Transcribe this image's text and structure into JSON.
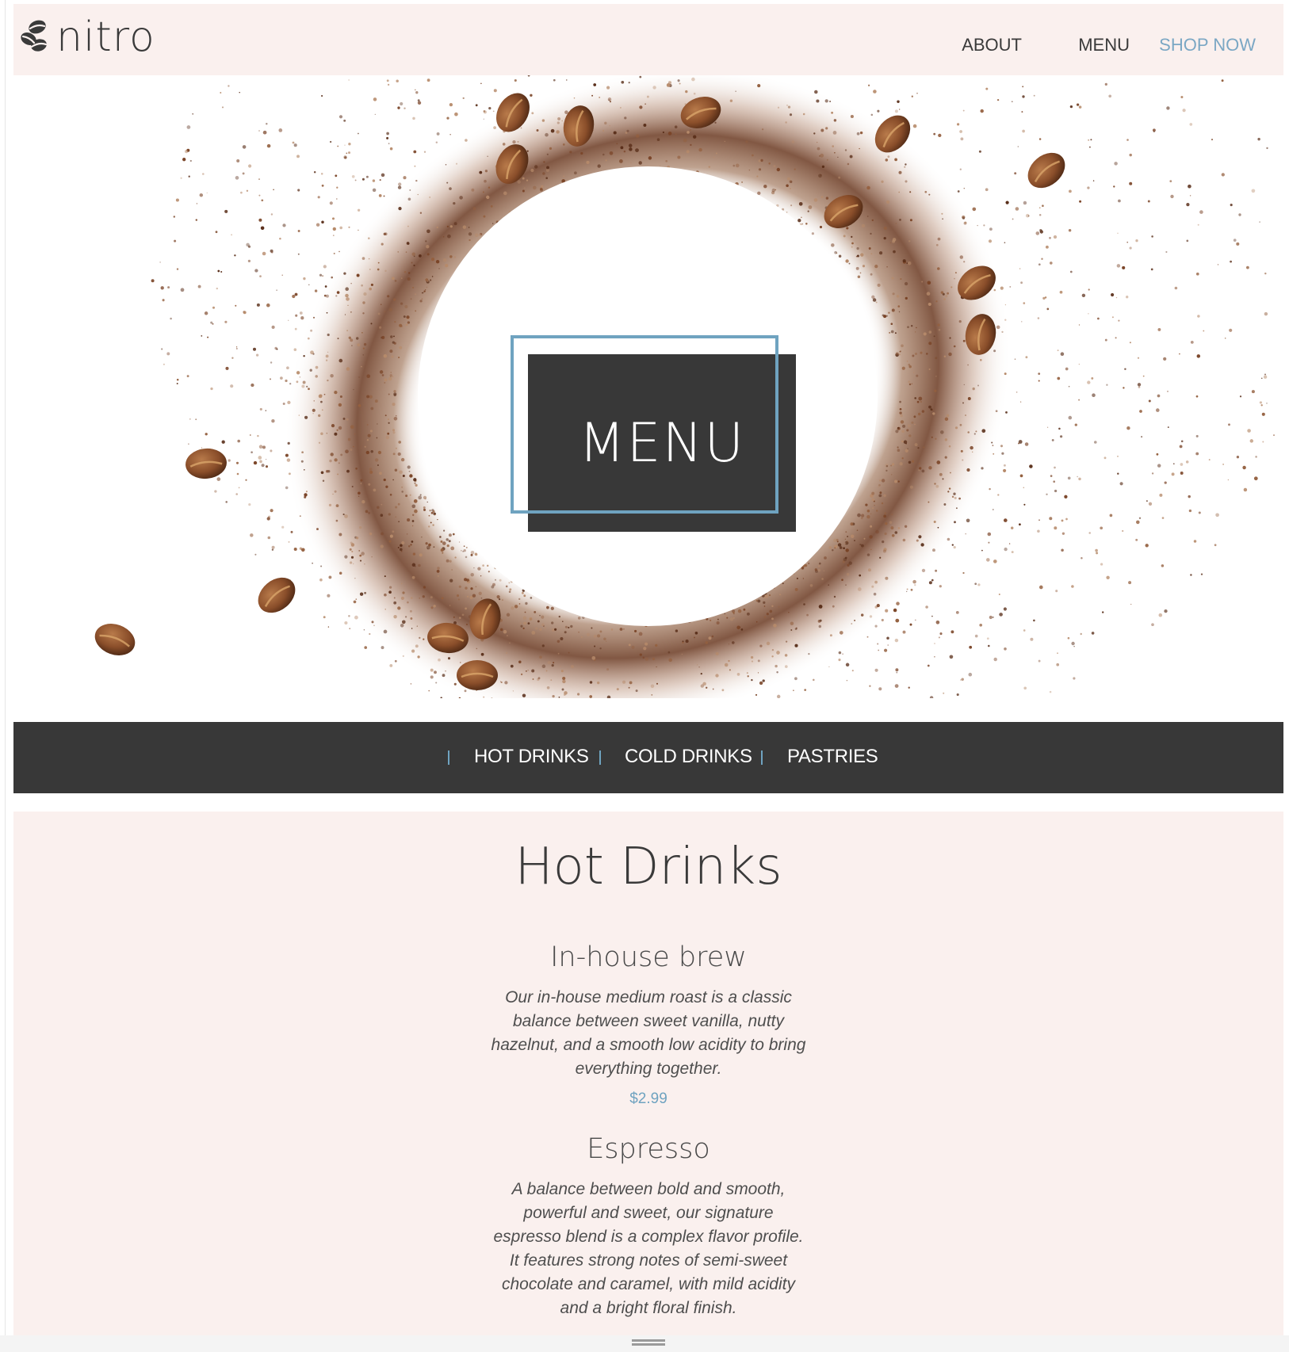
{
  "brand": {
    "name": "nitro",
    "logo_icon": "coffee-beans-icon"
  },
  "nav": {
    "about": "ABOUT",
    "menu": "MENU",
    "shop": "SHOP NOW"
  },
  "hero": {
    "title": "MENU"
  },
  "categories": [
    "HOT DRINKS",
    "COLD DRINKS",
    "PASTRIES"
  ],
  "section": {
    "title": "Hot Drinks",
    "items": [
      {
        "name": "In-house brew",
        "description": "Our in-house medium roast is a classic balance between sweet vanilla, nutty hazelnut, and a smooth low acidity to bring everything together.",
        "price": "$2.99"
      },
      {
        "name": "Espresso",
        "description": "A balance between bold and smooth, powerful and sweet, our signature espresso blend is a complex flavor profile. It features strong notes of semi-sweet chocolate and caramel, with mild acidity and a bright floral finish."
      }
    ]
  },
  "colors": {
    "accent": "#6fa3c0",
    "dark": "#383838",
    "cream": "#faf0ee",
    "coffee": "#6b3a22"
  }
}
